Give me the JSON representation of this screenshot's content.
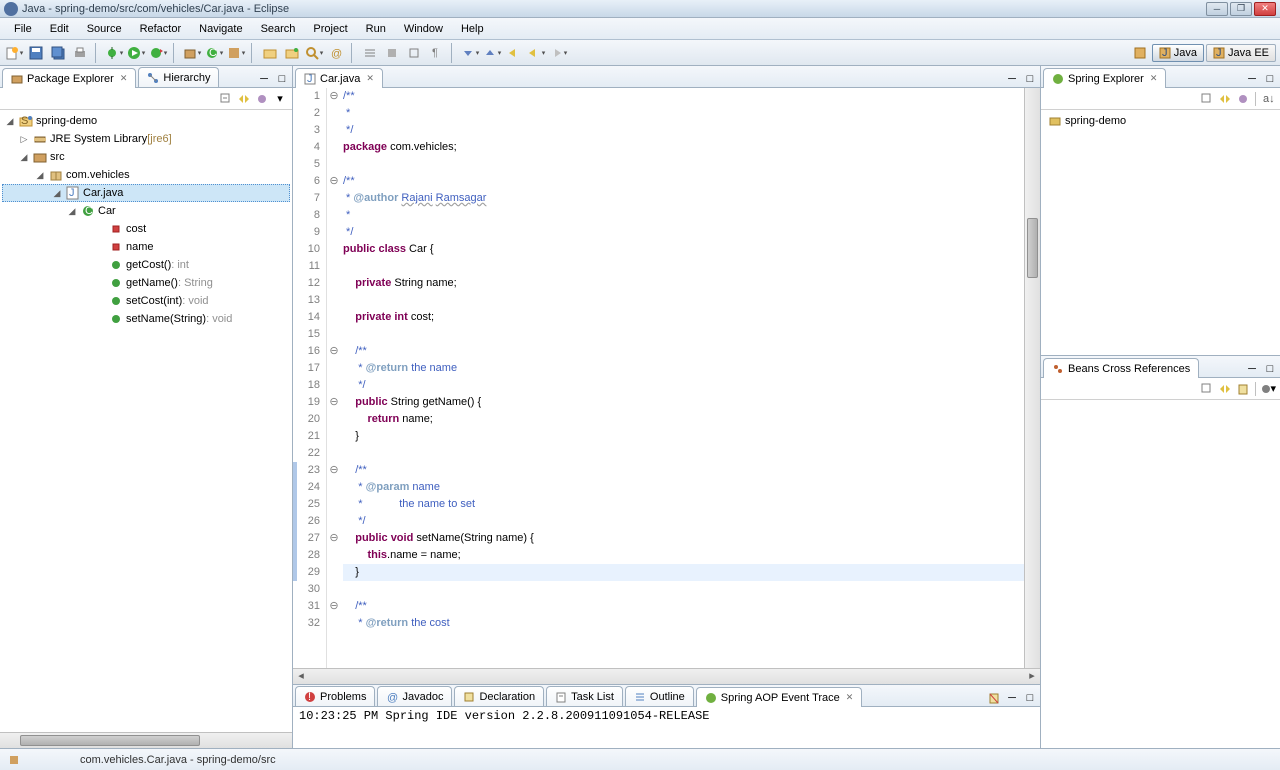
{
  "window": {
    "title": "Java - spring-demo/src/com/vehicles/Car.java - Eclipse"
  },
  "menu": [
    "File",
    "Edit",
    "Source",
    "Refactor",
    "Navigate",
    "Search",
    "Project",
    "Run",
    "Window",
    "Help"
  ],
  "perspectives": [
    {
      "label": "Java",
      "active": true
    },
    {
      "label": "Java EE",
      "active": false
    }
  ],
  "leftTabs": [
    {
      "label": "Package Explorer",
      "active": true
    },
    {
      "label": "Hierarchy",
      "active": false
    }
  ],
  "projectTree": {
    "project": "spring-demo",
    "jre": {
      "label": "JRE System Library",
      "extra": "[jre6]"
    },
    "src": "src",
    "package": "com.vehicles",
    "file": "Car.java",
    "class": "Car",
    "members": [
      {
        "name": "cost",
        "type": "",
        "kind": "field-private"
      },
      {
        "name": "name",
        "type": "",
        "kind": "field-private"
      },
      {
        "name": "getCost()",
        "type": " : int",
        "kind": "method-public"
      },
      {
        "name": "getName()",
        "type": " : String",
        "kind": "method-public"
      },
      {
        "name": "setCost(int)",
        "type": " : void",
        "kind": "method-public"
      },
      {
        "name": "setName(String)",
        "type": " : void",
        "kind": "method-public"
      }
    ]
  },
  "editor": {
    "tabLabel": "Car.java",
    "lines": [
      {
        "n": 1,
        "fold": "⊖",
        "segs": [
          {
            "t": "/**",
            "c": "cm"
          }
        ]
      },
      {
        "n": 2,
        "segs": [
          {
            "t": " *",
            "c": "cm"
          }
        ]
      },
      {
        "n": 3,
        "segs": [
          {
            "t": " */",
            "c": "cm"
          }
        ]
      },
      {
        "n": 4,
        "segs": [
          {
            "t": "package",
            "c": "kw"
          },
          {
            "t": " com.vehicles;"
          }
        ]
      },
      {
        "n": 5,
        "segs": []
      },
      {
        "n": 6,
        "fold": "⊖",
        "segs": [
          {
            "t": "/**",
            "c": "cm"
          }
        ]
      },
      {
        "n": 7,
        "segs": [
          {
            "t": " * ",
            "c": "cm"
          },
          {
            "t": "@author",
            "c": "cmtag"
          },
          {
            "t": " ",
            "c": "cm"
          },
          {
            "t": "Rajani",
            "c": "cm underline"
          },
          {
            "t": " ",
            "c": "cm"
          },
          {
            "t": "Ramsagar",
            "c": "cm underline"
          }
        ]
      },
      {
        "n": 8,
        "segs": [
          {
            "t": " *",
            "c": "cm"
          }
        ]
      },
      {
        "n": 9,
        "segs": [
          {
            "t": " */",
            "c": "cm"
          }
        ]
      },
      {
        "n": 10,
        "segs": [
          {
            "t": "public",
            "c": "kw"
          },
          {
            "t": " "
          },
          {
            "t": "class",
            "c": "kw"
          },
          {
            "t": " Car {"
          }
        ]
      },
      {
        "n": 11,
        "segs": []
      },
      {
        "n": 12,
        "segs": [
          {
            "t": "    "
          },
          {
            "t": "private",
            "c": "kw"
          },
          {
            "t": " String name;"
          }
        ]
      },
      {
        "n": 13,
        "segs": []
      },
      {
        "n": 14,
        "segs": [
          {
            "t": "    "
          },
          {
            "t": "private",
            "c": "kw"
          },
          {
            "t": " "
          },
          {
            "t": "int",
            "c": "kw"
          },
          {
            "t": " cost;"
          }
        ]
      },
      {
        "n": 15,
        "segs": []
      },
      {
        "n": 16,
        "fold": "⊖",
        "segs": [
          {
            "t": "    /**",
            "c": "cm"
          }
        ]
      },
      {
        "n": 17,
        "segs": [
          {
            "t": "     * ",
            "c": "cm"
          },
          {
            "t": "@return",
            "c": "cmtag"
          },
          {
            "t": " the name",
            "c": "cm"
          }
        ]
      },
      {
        "n": 18,
        "segs": [
          {
            "t": "     */",
            "c": "cm"
          }
        ]
      },
      {
        "n": 19,
        "fold": "⊖",
        "segs": [
          {
            "t": "    "
          },
          {
            "t": "public",
            "c": "kw"
          },
          {
            "t": " String getName() {"
          }
        ]
      },
      {
        "n": 20,
        "segs": [
          {
            "t": "        "
          },
          {
            "t": "return",
            "c": "kw"
          },
          {
            "t": " name;"
          }
        ]
      },
      {
        "n": 21,
        "segs": [
          {
            "t": "    }"
          }
        ]
      },
      {
        "n": 22,
        "segs": []
      },
      {
        "n": 23,
        "fold": "⊖",
        "changed": true,
        "segs": [
          {
            "t": "    /**",
            "c": "cm"
          }
        ]
      },
      {
        "n": 24,
        "changed": true,
        "segs": [
          {
            "t": "     * ",
            "c": "cm"
          },
          {
            "t": "@param",
            "c": "cmtag"
          },
          {
            "t": " name",
            "c": "cm"
          }
        ]
      },
      {
        "n": 25,
        "changed": true,
        "segs": [
          {
            "t": "     *            the name to set",
            "c": "cm"
          }
        ]
      },
      {
        "n": 26,
        "changed": true,
        "segs": [
          {
            "t": "     */",
            "c": "cm"
          }
        ]
      },
      {
        "n": 27,
        "fold": "⊖",
        "changed": true,
        "segs": [
          {
            "t": "    "
          },
          {
            "t": "public",
            "c": "kw"
          },
          {
            "t": " "
          },
          {
            "t": "void",
            "c": "kw"
          },
          {
            "t": " setName(String name) {"
          }
        ]
      },
      {
        "n": 28,
        "changed": true,
        "segs": [
          {
            "t": "        "
          },
          {
            "t": "this",
            "c": "kw"
          },
          {
            "t": ".name = name;"
          }
        ]
      },
      {
        "n": 29,
        "changed": true,
        "current": true,
        "segs": [
          {
            "t": "    }"
          }
        ]
      },
      {
        "n": 30,
        "segs": []
      },
      {
        "n": 31,
        "fold": "⊖",
        "segs": [
          {
            "t": "    /**",
            "c": "cm"
          }
        ]
      },
      {
        "n": 32,
        "segs": [
          {
            "t": "     * ",
            "c": "cm"
          },
          {
            "t": "@return",
            "c": "cmtag"
          },
          {
            "t": " the cost",
            "c": "cm"
          }
        ]
      }
    ]
  },
  "rightTop": {
    "tab": "Spring Explorer",
    "node": "spring-demo"
  },
  "rightBottom": {
    "tab": "Beans Cross References"
  },
  "bottomTabs": [
    "Problems",
    "Javadoc",
    "Declaration",
    "Task List",
    "Outline",
    "Spring AOP Event Trace"
  ],
  "console": "10:23:25 PM Spring IDE version 2.2.8.200911091054-RELEASE",
  "status": "com.vehicles.Car.java - spring-demo/src"
}
